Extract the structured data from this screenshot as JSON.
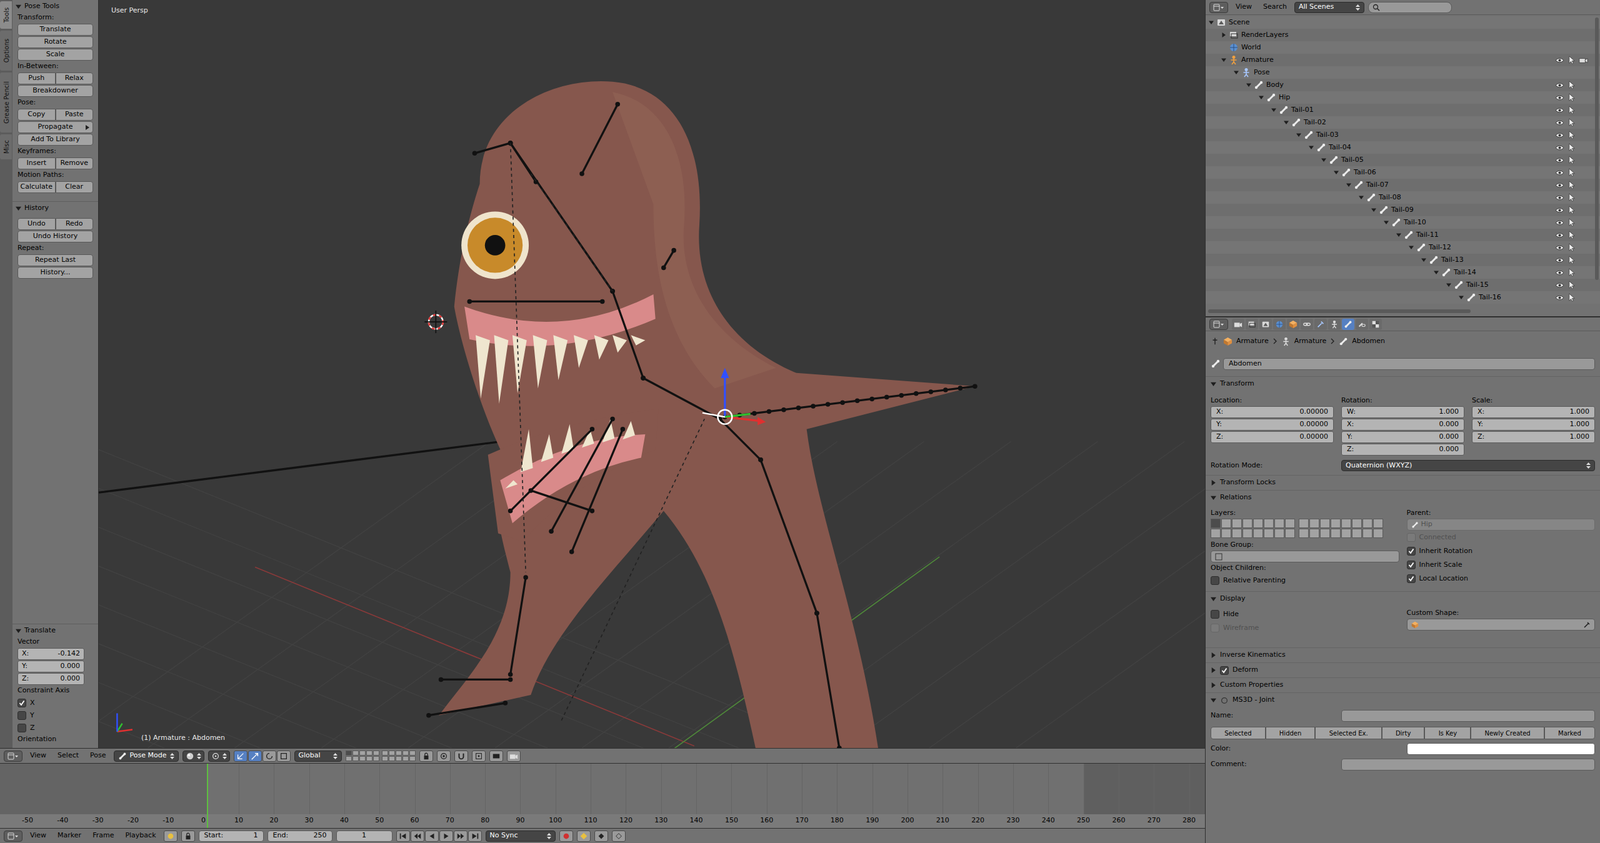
{
  "tool_shelf": {
    "tabs": [
      {
        "label": "Tools",
        "selected": true
      },
      {
        "label": "Options",
        "selected": false
      },
      {
        "label": "Grease Pencil",
        "selected": false
      },
      {
        "label": "Misc",
        "selected": false
      }
    ],
    "panels": [
      {
        "title": "Pose Tools",
        "expanded": true,
        "sections": [
          {
            "label": "Transform:",
            "rows": [
              [
                {
                  "label": "Translate",
                  "kind": "button"
                }
              ],
              [
                {
                  "label": "Rotate",
                  "kind": "button"
                }
              ],
              [
                {
                  "label": "Scale",
                  "kind": "button"
                }
              ]
            ]
          },
          {
            "label": "In-Between:",
            "rows": [
              [
                {
                  "label": "Push",
                  "kind": "button"
                },
                {
                  "label": "Relax",
                  "kind": "button"
                }
              ],
              [
                {
                  "label": "Breakdowner",
                  "kind": "button"
                }
              ]
            ]
          },
          {
            "label": "Pose:",
            "rows": [
              [
                {
                  "label": "Copy",
                  "kind": "button"
                },
                {
                  "label": "Paste",
                  "kind": "button"
                }
              ],
              [
                {
                  "label": "Propagate",
                  "kind": "menu"
                }
              ],
              [
                {
                  "label": "Add To Library",
                  "kind": "button"
                }
              ]
            ]
          },
          {
            "label": "Keyframes:",
            "rows": [
              [
                {
                  "label": "Insert",
                  "kind": "button"
                },
                {
                  "label": "Remove",
                  "kind": "button"
                }
              ]
            ]
          },
          {
            "label": "Motion Paths:",
            "rows": [
              [
                {
                  "label": "Calculate",
                  "kind": "button"
                },
                {
                  "label": "Clear",
                  "kind": "button"
                }
              ]
            ]
          }
        ]
      },
      {
        "title": "History",
        "expanded": true,
        "sections": [
          {
            "rows": [
              [
                {
                  "label": "Undo",
                  "kind": "button"
                },
                {
                  "label": "Redo",
                  "kind": "button"
                }
              ],
              [
                {
                  "label": "Undo History",
                  "kind": "button"
                }
              ]
            ]
          },
          {
            "label": "Repeat:",
            "rows": [
              [
                {
                  "label": "Repeat Last",
                  "kind": "button"
                }
              ],
              [
                {
                  "label": "History...",
                  "kind": "button"
                }
              ]
            ]
          }
        ]
      }
    ],
    "operator": {
      "title": "Translate",
      "expanded": true,
      "vector_label": "Vector",
      "vector": [
        {
          "axis": "X:",
          "value": "-0.142"
        },
        {
          "axis": "Y:",
          "value": "0.000"
        },
        {
          "axis": "Z:",
          "value": "0.000"
        }
      ],
      "constraint_label": "Constraint Axis",
      "constraints": [
        {
          "label": "X",
          "checked": true
        },
        {
          "label": "Y",
          "checked": false
        },
        {
          "label": "Z",
          "checked": false
        }
      ],
      "orientation_label": "Orientation"
    }
  },
  "viewport": {
    "view_label": "User Persp",
    "status": "(1) Armature : Abdomen"
  },
  "viewport_header": {
    "menus": [
      "View",
      "Select",
      "Pose"
    ],
    "mode": "Pose Mode",
    "orientation": "Global",
    "toggles": [
      {
        "kind": "manipulator",
        "selected": true
      },
      {
        "kind": "translate",
        "selected": true
      },
      {
        "kind": "rotate",
        "selected": false
      },
      {
        "kind": "scale",
        "selected": false
      }
    ],
    "layers": [
      true,
      false,
      false,
      false,
      false,
      false,
      false,
      false,
      false,
      false,
      false,
      false,
      false,
      false,
      false,
      false,
      false,
      false,
      false,
      false
    ]
  },
  "timeline": {
    "ruler": [
      "-50",
      "-40",
      "-30",
      "-20",
      "-10",
      "0",
      "10",
      "20",
      "30",
      "40",
      "50",
      "60",
      "70",
      "80",
      "90",
      "100",
      "110",
      "120",
      "130",
      "140",
      "150",
      "160",
      "170",
      "180",
      "190",
      "200",
      "210",
      "220",
      "230",
      "240",
      "250",
      "260",
      "270",
      "280"
    ],
    "playhead_frame": 1,
    "menus": [
      "View",
      "Marker",
      "Frame",
      "Playback"
    ],
    "start_label": "Start:",
    "start": "1",
    "end_label": "End:",
    "end": "250",
    "current": "1",
    "sync": "No Sync"
  },
  "outliner": {
    "menus": [
      "View",
      "Search"
    ],
    "scope": "All Scenes",
    "rows": [
      {
        "name": "Scene",
        "depth": 0,
        "kind": "scene",
        "disclosure": "open",
        "restrict_columns": 0
      },
      {
        "name": "RenderLayers",
        "depth": 1,
        "kind": "render_layers",
        "disclosure": "closed",
        "restrict_columns": 0
      },
      {
        "name": "World",
        "depth": 1,
        "kind": "world",
        "disclosure": "none",
        "restrict_columns": 0
      },
      {
        "name": "Armature",
        "depth": 1,
        "kind": "armature",
        "disclosure": "open",
        "restrict_columns": 3
      },
      {
        "name": "Pose",
        "depth": 2,
        "kind": "pose",
        "disclosure": "open",
        "restrict_columns": 0
      },
      {
        "name": "Body",
        "depth": 3,
        "kind": "bone",
        "disclosure": "open",
        "restrict_columns": 2
      },
      {
        "name": "Hip",
        "depth": 4,
        "kind": "bone",
        "disclosure": "open",
        "restrict_columns": 2
      },
      {
        "name": "Tail-01",
        "depth": 5,
        "kind": "bone",
        "disclosure": "open",
        "restrict_columns": 2
      },
      {
        "name": "Tail-02",
        "depth": 6,
        "kind": "bone",
        "disclosure": "open",
        "restrict_columns": 2
      },
      {
        "name": "Tail-03",
        "depth": 7,
        "kind": "bone",
        "disclosure": "open",
        "restrict_columns": 2
      },
      {
        "name": "Tail-04",
        "depth": 8,
        "kind": "bone",
        "disclosure": "open",
        "restrict_columns": 2
      },
      {
        "name": "Tail-05",
        "depth": 9,
        "kind": "bone",
        "disclosure": "open",
        "restrict_columns": 2
      },
      {
        "name": "Tail-06",
        "depth": 10,
        "kind": "bone",
        "disclosure": "open",
        "restrict_columns": 2
      },
      {
        "name": "Tail-07",
        "depth": 11,
        "kind": "bone",
        "disclosure": "open",
        "restrict_columns": 2
      },
      {
        "name": "Tail-08",
        "depth": 12,
        "kind": "bone",
        "disclosure": "open",
        "restrict_columns": 2
      },
      {
        "name": "Tail-09",
        "depth": 13,
        "kind": "bone",
        "disclosure": "open",
        "restrict_columns": 2
      },
      {
        "name": "Tail-10",
        "depth": 14,
        "kind": "bone",
        "disclosure": "open",
        "restrict_columns": 2
      },
      {
        "name": "Tail-11",
        "depth": 15,
        "kind": "bone",
        "disclosure": "open",
        "restrict_columns": 2
      },
      {
        "name": "Tail-12",
        "depth": 16,
        "kind": "bone",
        "disclosure": "open",
        "restrict_columns": 2
      },
      {
        "name": "Tail-13",
        "depth": 17,
        "kind": "bone",
        "disclosure": "open",
        "restrict_columns": 2
      },
      {
        "name": "Tail-14",
        "depth": 18,
        "kind": "bone",
        "disclosure": "open",
        "restrict_columns": 2
      },
      {
        "name": "Tail-15",
        "depth": 19,
        "kind": "bone",
        "disclosure": "open",
        "restrict_columns": 2
      },
      {
        "name": "Tail-16",
        "depth": 20,
        "kind": "bone",
        "disclosure": "open",
        "restrict_columns": 2
      }
    ]
  },
  "properties": {
    "context_tabs": [
      {
        "kind": "render",
        "selected": false
      },
      {
        "kind": "render_layers",
        "selected": false
      },
      {
        "kind": "scene",
        "selected": false
      },
      {
        "kind": "world",
        "selected": false
      },
      {
        "kind": "object",
        "selected": false
      },
      {
        "kind": "constraints",
        "selected": false
      },
      {
        "kind": "modifiers",
        "selected": false
      },
      {
        "kind": "data",
        "selected": false
      },
      {
        "kind": "bone",
        "selected": true
      },
      {
        "kind": "bone_constraints",
        "selected": false
      },
      {
        "kind": "texture",
        "selected": false
      }
    ],
    "breadcrumb": [
      "Armature",
      "Armature",
      "Abdomen"
    ],
    "bone_name": "Abdomen",
    "transform": {
      "title": "Transform",
      "expanded": true,
      "columns": [
        {
          "label": "Location:",
          "fields": [
            {
              "axis": "X:",
              "value": "0.00000"
            },
            {
              "axis": "Y:",
              "value": "0.00000"
            },
            {
              "axis": "Z:",
              "value": "0.00000"
            }
          ]
        },
        {
          "label": "Rotation:",
          "fields": [
            {
              "axis": "W:",
              "value": "1.000"
            },
            {
              "axis": "X:",
              "value": "0.000"
            },
            {
              "axis": "Y:",
              "value": "0.000"
            },
            {
              "axis": "Z:",
              "value": "0.000"
            }
          ]
        },
        {
          "label": "Scale:",
          "fields": [
            {
              "axis": "X:",
              "value": "1.000"
            },
            {
              "axis": "Y:",
              "value": "1.000"
            },
            {
              "axis": "Z:",
              "value": "1.000"
            }
          ]
        }
      ],
      "rotation_mode_label": "Rotation Mode:",
      "rotation_mode": "Quaternion (WXYZ)"
    },
    "transform_locks": {
      "title": "Transform Locks",
      "expanded": false
    },
    "relations": {
      "title": "Relations",
      "expanded": true,
      "layers_label": "Layers:",
      "layers": [
        true,
        false,
        false,
        false,
        false,
        false,
        false,
        false,
        false,
        false,
        false,
        false,
        false,
        false,
        false,
        false,
        false,
        false,
        false,
        false,
        false,
        false,
        false,
        false,
        false,
        false,
        false,
        false,
        false,
        false,
        false,
        false
      ],
      "parent_label": "Parent:",
      "parent": "Hip",
      "parent_disabled": true,
      "bone_group_label": "Bone Group:",
      "object_children_label": "Object Children:",
      "options": [
        {
          "label": "Connected",
          "checked": false,
          "disabled": true
        },
        {
          "label": "Inherit Rotation",
          "checked": true,
          "disabled": false
        },
        {
          "label": "Inherit Scale",
          "checked": true,
          "disabled": false
        },
        {
          "label": "Local Location",
          "checked": true,
          "disabled": false
        }
      ],
      "relative_parenting": {
        "label": "Relative Parenting",
        "checked": false
      }
    },
    "display": {
      "title": "Display",
      "expanded": true,
      "options": [
        {
          "label": "Hide",
          "checked": false,
          "disabled": false
        },
        {
          "label": "Wireframe",
          "checked": false,
          "disabled": true
        }
      ],
      "custom_shape_label": "Custom Shape:"
    },
    "collapsed_panels": [
      {
        "title": "Inverse Kinematics",
        "expanded": false,
        "kind": "plain",
        "checked": false
      },
      {
        "title": "Deform",
        "expanded": false,
        "kind": "checkbox",
        "checked": true
      },
      {
        "title": "Custom Properties",
        "expanded": false,
        "kind": "plain",
        "checked": false
      }
    ],
    "ms3d": {
      "title": "MS3D - Joint",
      "expanded": true,
      "name_label": "Name:",
      "flags": [
        {
          "label": "Selected",
          "on": false
        },
        {
          "label": "Hidden",
          "on": false
        },
        {
          "label": "Selected Ex.",
          "on": false
        },
        {
          "label": "Dirty",
          "on": false
        },
        {
          "label": "Is Key",
          "on": false
        },
        {
          "label": "Newly Created",
          "on": false
        },
        {
          "label": "Marked",
          "on": false
        }
      ],
      "color_label": "Color:",
      "color": "#ffffff",
      "comment_label": "Comment:"
    }
  }
}
